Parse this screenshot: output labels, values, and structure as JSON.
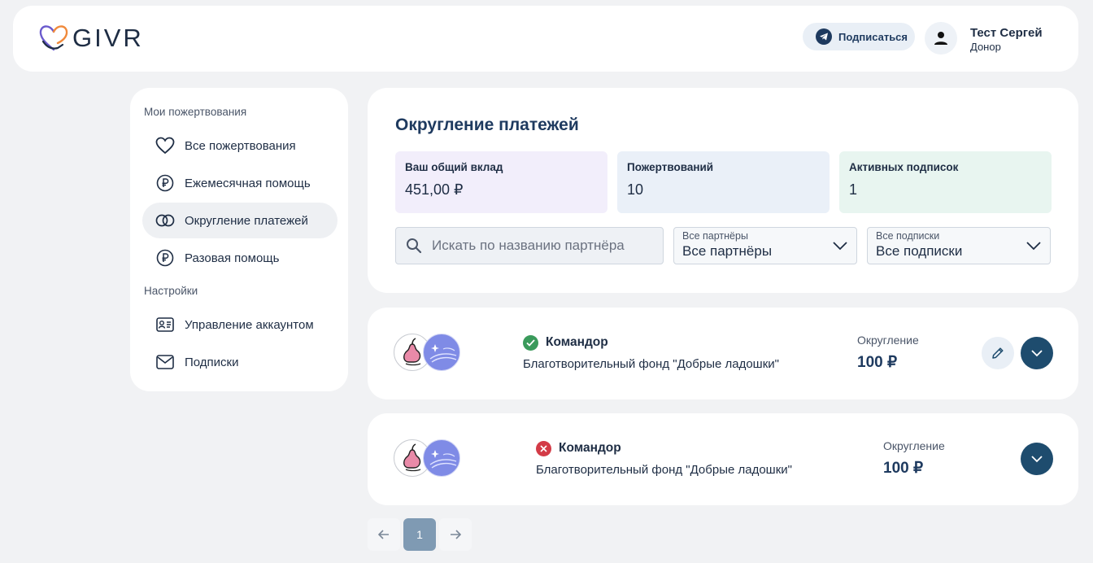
{
  "header": {
    "logo_text": "GIVR",
    "subscribe_label": "Подписаться",
    "user_name": "Тест Сергей",
    "user_role": "Донор"
  },
  "sidebar": {
    "section_donations": "Мои пожертвования",
    "section_settings": "Настройки",
    "items": [
      {
        "label": "Все пожертвования",
        "icon": "heart-icon"
      },
      {
        "label": "Ежемесячная помощь",
        "icon": "ruble-circle-icon"
      },
      {
        "label": "Округление платежей",
        "icon": "rings-icon",
        "active": true
      },
      {
        "label": "Разовая помощь",
        "icon": "ruble-circle-icon"
      },
      {
        "label": "Управление аккаунтом",
        "icon": "id-card-icon"
      },
      {
        "label": "Подписки",
        "icon": "envelope-icon"
      }
    ]
  },
  "main": {
    "title": "Округление платежей",
    "stats": [
      {
        "label": "Ваш общий вклад",
        "value": "451,00 ₽",
        "color": "#f2eefb"
      },
      {
        "label": "Пожертвований",
        "value": "10",
        "color": "#eaf0f8"
      },
      {
        "label": "Активных подписок",
        "value": "1",
        "color": "#e8f5f0"
      }
    ],
    "search_placeholder": "Искать по названию партнёра",
    "partner_filter": {
      "label": "Все партнёры",
      "value": "Все партнёры"
    },
    "subscription_filter": {
      "label": "Все подписки",
      "value": "Все подписки"
    }
  },
  "subscriptions": [
    {
      "name": "Командор",
      "fund": "Благотворительный фонд \"Добрые ладошки\"",
      "status": "active",
      "amount_label": "Округление",
      "amount": "100 ₽"
    },
    {
      "name": "Командор",
      "fund": "Благотворительный фонд \"Добрые ладошки\"",
      "status": "inactive",
      "amount_label": "Округление",
      "amount": "100 ₽"
    }
  ],
  "pagination": {
    "current": "1"
  },
  "colors": {
    "accent": "#1e4c6e",
    "active_status": "#3a9a5b",
    "inactive_status": "#d33b47"
  }
}
